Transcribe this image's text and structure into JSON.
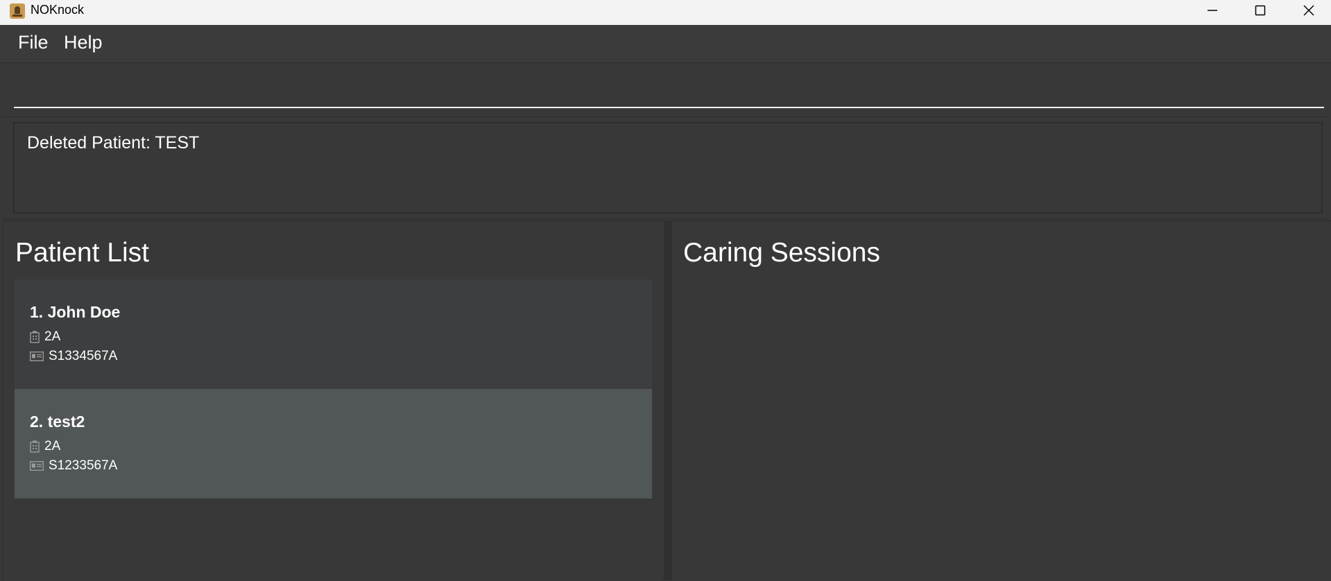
{
  "window": {
    "title": "NOKnock"
  },
  "menu": {
    "file": "File",
    "help": "Help"
  },
  "command": {
    "value": ""
  },
  "result": {
    "text": "Deleted Patient: TEST"
  },
  "patient_panel": {
    "title": "Patient List",
    "patients": [
      {
        "name": "1. John Doe",
        "ward": "2A",
        "ic": "S1334567A"
      },
      {
        "name": "2. test2",
        "ward": "2A",
        "ic": "S1233567A"
      }
    ]
  },
  "session_panel": {
    "title": "Caring Sessions"
  },
  "icons": {
    "ward": "hospital-icon",
    "ic": "id-card-icon"
  },
  "colors": {
    "background": "#383838",
    "selected_row": "#515658",
    "app_icon": "#c89a50"
  }
}
